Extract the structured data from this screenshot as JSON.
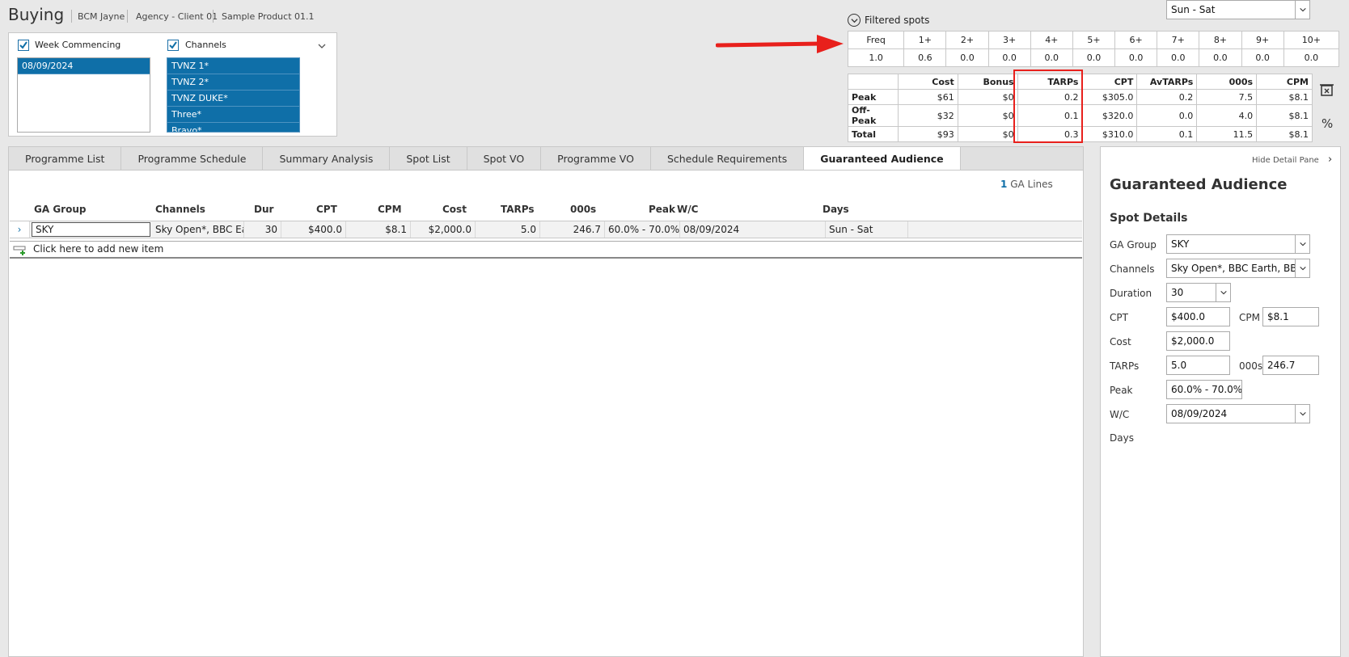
{
  "header": {
    "title": "Buying",
    "breadcrumbs": [
      "BCM Jayne",
      "Agency - Client 01",
      "Sample Product 01.1"
    ]
  },
  "filters": {
    "week": {
      "label": "Week Commencing",
      "checked": true,
      "items": [
        "08/09/2024"
      ]
    },
    "channels": {
      "label": "Channels",
      "checked": true,
      "items": [
        "TVNZ 1*",
        "TVNZ 2*",
        "TVNZ DUKE*",
        "Three*",
        "Bravo*"
      ]
    }
  },
  "filtered_spots": {
    "title": "Filtered spots",
    "freq_headers": [
      "Freq",
      "1+",
      "2+",
      "3+",
      "4+",
      "5+",
      "6+",
      "7+",
      "8+",
      "9+",
      "10+"
    ],
    "freq_values": [
      "1.0",
      "0.6",
      "0.0",
      "0.0",
      "0.0",
      "0.0",
      "0.0",
      "0.0",
      "0.0",
      "0.0",
      "0.0"
    ],
    "summary_headers": [
      "",
      "Cost",
      "Bonus",
      "TARPs",
      "CPT",
      "AvTARPs",
      "000s",
      "CPM"
    ],
    "summary_rows": [
      [
        "Peak",
        "$61",
        "$0",
        "0.2",
        "$305.0",
        "0.2",
        "7.5",
        "$8.1"
      ],
      [
        "Off-Peak",
        "$32",
        "$0",
        "0.1",
        "$320.0",
        "0.0",
        "4.0",
        "$8.1"
      ],
      [
        "Total",
        "$93",
        "$0",
        "0.3",
        "$310.0",
        "0.1",
        "11.5",
        "$8.1"
      ]
    ],
    "percent_symbol": "%"
  },
  "tabs": [
    {
      "label": "Programme List",
      "active": false
    },
    {
      "label": "Programme Schedule",
      "active": false
    },
    {
      "label": "Summary Analysis",
      "active": false
    },
    {
      "label": "Spot List",
      "active": false
    },
    {
      "label": "Spot VO",
      "active": false
    },
    {
      "label": "Programme VO",
      "active": false
    },
    {
      "label": "Schedule Requirements",
      "active": false
    },
    {
      "label": "Guaranteed Audience",
      "active": true
    }
  ],
  "grid": {
    "line_count": "1",
    "line_label": "GA Lines",
    "headers": [
      "GA Group",
      "Channels",
      "Dur",
      "CPT",
      "CPM",
      "Cost",
      "TARPs",
      "000s",
      "Peak",
      "W/C",
      "Days"
    ],
    "rows": [
      [
        "SKY",
        "Sky Open*, BBC Ea",
        "30",
        "$400.0",
        "$8.1",
        "$2,000.0",
        "5.0",
        "246.7",
        "60.0% - 70.0%",
        "08/09/2024",
        "Sun - Sat"
      ]
    ],
    "add_item_label": "Click here to add new item"
  },
  "detail": {
    "hide_label": "Hide Detail Pane",
    "title": "Guaranteed Audience",
    "section": "Spot Details",
    "ga_group": {
      "label": "GA Group",
      "value": "SKY"
    },
    "channels": {
      "label": "Channels",
      "value": "Sky Open*, BBC Earth, BBC UKTV"
    },
    "duration": {
      "label": "Duration",
      "value": "30"
    },
    "cpt": {
      "label": "CPT",
      "value": "$400.0"
    },
    "cpm": {
      "label": "CPM",
      "value": "$8.1"
    },
    "cost": {
      "label": "Cost",
      "value": "$2,000.0"
    },
    "tarps": {
      "label": "TARPs",
      "value": "5.0"
    },
    "thousands": {
      "label": "000s",
      "value": "246.7"
    },
    "peak": {
      "label": "Peak",
      "value": "60.0% - 70.0%"
    },
    "wc": {
      "label": "W/C",
      "value": "08/09/2024"
    },
    "days": {
      "label": "Days",
      "value": "Sun - Sat"
    }
  },
  "colors": {
    "accent": "#0f6fa8",
    "annotation_red": "#e8201c"
  }
}
